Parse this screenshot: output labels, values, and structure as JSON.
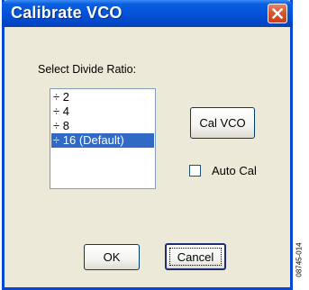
{
  "window": {
    "title": "Calibrate VCO"
  },
  "divide_ratio": {
    "label": "Select Divide Ratio:",
    "options": [
      "÷ 2",
      "÷ 4",
      "÷ 8",
      "÷ 16 (Default)"
    ],
    "selected": "÷ 16 (Default)"
  },
  "buttons": {
    "cal_vco": "Cal VCO",
    "ok": "OK",
    "cancel": "Cancel"
  },
  "auto_cal": {
    "label": "Auto Cal",
    "checked": false
  },
  "figure_code": "08745-014",
  "colors": {
    "titlebar": "#0453d8",
    "selection": "#316ac5",
    "dialog_bg": "#ece9d8",
    "close_button": "#d9572f"
  },
  "icons": {
    "close": "close-x-icon"
  }
}
